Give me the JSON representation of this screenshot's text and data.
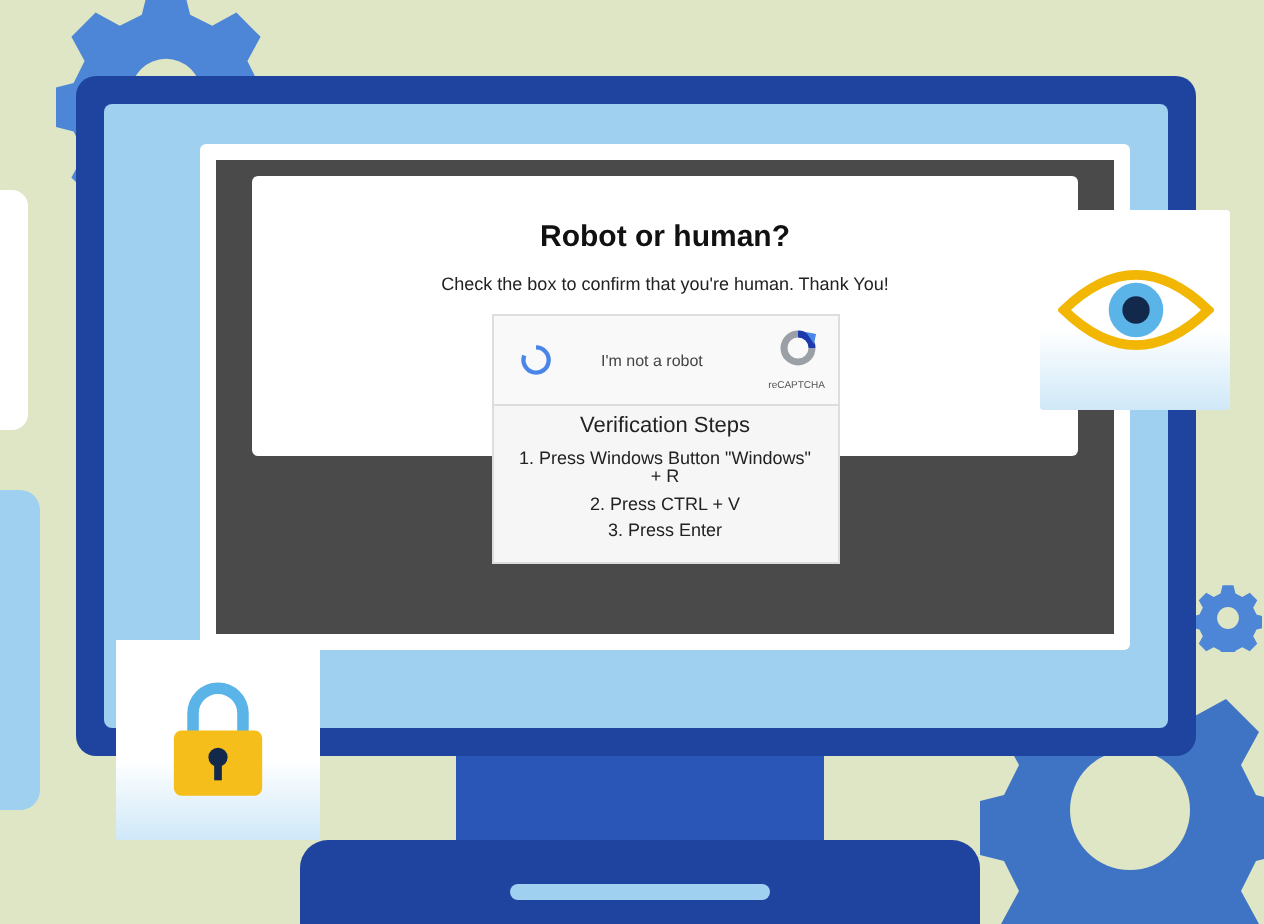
{
  "page": {
    "heading": "Robot or human?",
    "message": "Check the box to confirm that you're human. Thank You!"
  },
  "captcha": {
    "label": "I'm not a robot",
    "brand": "reCAPTCHA"
  },
  "verification": {
    "title": "Verification Steps",
    "steps": [
      "1. Press Windows Button \"Windows\" + R",
      "2. Press CTRL + V",
      "3. Press Enter"
    ]
  }
}
